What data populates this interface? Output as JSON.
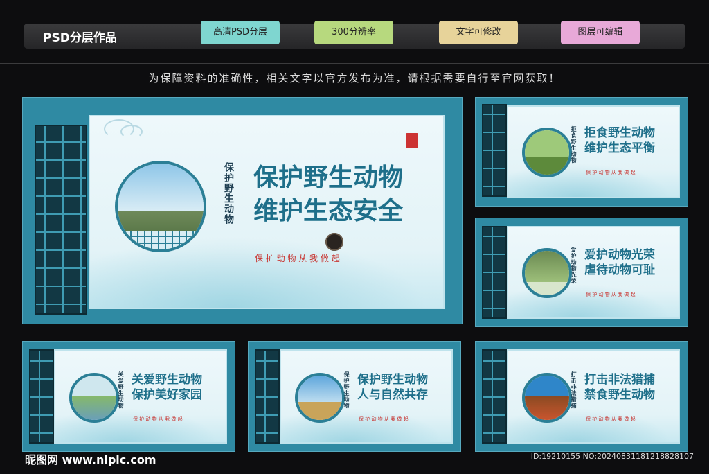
{
  "header": {
    "brand": "PSD分层作品",
    "tags": [
      {
        "label": "高清PSD分层",
        "color": "#7fd6d0"
      },
      {
        "label": "300分辨率",
        "color": "#b7d97e"
      },
      {
        "label": "文字可修改",
        "color": "#e7d39a"
      },
      {
        "label": "图层可编辑",
        "color": "#e8a9d8"
      }
    ]
  },
  "notice": "为保障资料的准确性，相关文字以官方发布为准，请根据需要自行至官网获取！",
  "main_board": {
    "vertical": "保护野生动物",
    "line1": "保护野生动物",
    "line2": "维护生态安全",
    "slogan": "保 护 动 物   从 我 做 起"
  },
  "boards": [
    {
      "vertical": "拒食野生动物",
      "line1": "拒食野生动物",
      "line2": "维护生态平衡",
      "slogan": "保 护 动 物   从 我 做 起"
    },
    {
      "vertical": "爱护动物光荣",
      "line1": "爱护动物光荣",
      "line2": "虐待动物可耻",
      "slogan": "保 护 动 物   从 我 做 起"
    },
    {
      "vertical": "关爱野生动物",
      "line1": "关爱野生动物",
      "line2": "保护美好家园",
      "slogan": "保 护 动 物   从 我 做 起"
    },
    {
      "vertical": "保护野生动物",
      "line1": "保护野生动物",
      "line2": "人与自然共存",
      "slogan": "保 护 动 物   从 我 做 起"
    },
    {
      "vertical": "打击非法猎捕",
      "line1": "打击非法猎捕",
      "line2": "禁食野生动物",
      "slogan": "保 护 动 物   从 我 做 起"
    }
  ],
  "footer": {
    "left": "昵图网 www.nipic.com",
    "right": "ID:19210155 NO:20240831181218828107"
  }
}
